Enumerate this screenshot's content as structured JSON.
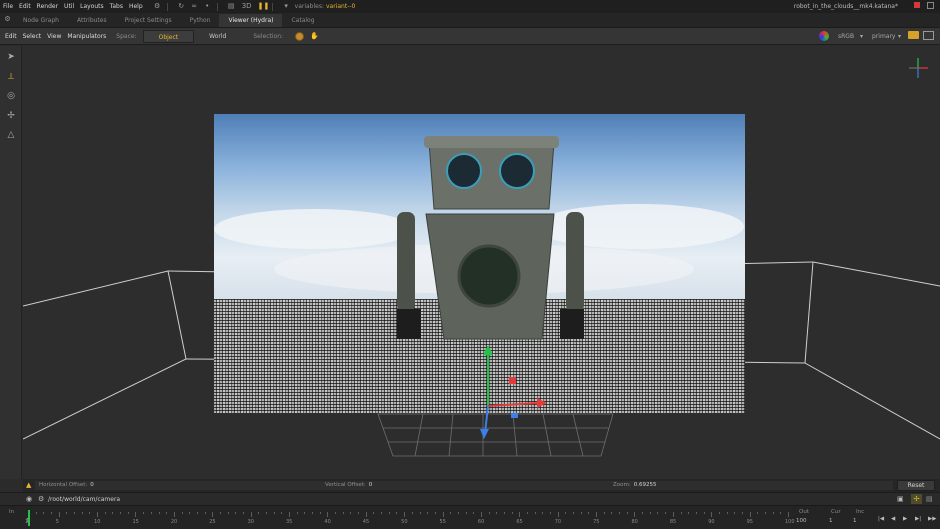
{
  "menubar": {
    "items": [
      "File",
      "Edit",
      "Render",
      "Util",
      "Layouts",
      "Tabs",
      "Help"
    ],
    "variable_label": "variables:",
    "variable_value": "variant--0",
    "file_name": "robot_in_the_clouds__mk4.katana*",
    "icons": [
      "render-icon",
      "undo-icon",
      "link-icon",
      "dot-icon",
      "stack-icon",
      "pause-icon",
      "3d-label"
    ]
  },
  "tabs": [
    "Node Graph",
    "Attributes",
    "Project Settings",
    "Python",
    "Viewer (Hydra)",
    "Catalog"
  ],
  "active_tab": "Viewer (Hydra)",
  "viewer_toolbar": {
    "menus": [
      "Edit",
      "Select",
      "View",
      "Manipulators"
    ],
    "space_label": "Space:",
    "space_options": [
      "Object",
      "World"
    ],
    "space_selected": "Object",
    "selection_label": "Selection:",
    "color_space": "sRGB",
    "display": "primary",
    "threed_label": "3D"
  },
  "status": {
    "h_offset_label": "Horizontal Offset:",
    "h_offset_value": "0",
    "v_offset_label": "Vertical Offset:",
    "v_offset_value": "0",
    "zoom_label": "Zoom:",
    "zoom_value": "0.69255",
    "reset_label": "Reset"
  },
  "camera_path": "/root/world/cam/camera",
  "timeline": {
    "in_label": "In",
    "in_value": "1",
    "ticks": [
      "1",
      "5",
      "10",
      "15",
      "20",
      "25",
      "30",
      "35",
      "40",
      "45",
      "50",
      "55",
      "60",
      "65",
      "70",
      "75",
      "80",
      "85",
      "90",
      "95",
      "100"
    ],
    "out_label": "Out",
    "out_value": "100",
    "cur_label": "Cur",
    "cur_value": "1",
    "inc_label": "Inc",
    "inc_value": "1"
  },
  "colors": {
    "accent": "#e6b532",
    "manip_green": "#22c34a",
    "manip_red": "#e23b3b",
    "manip_blue": "#3d7fe6"
  }
}
